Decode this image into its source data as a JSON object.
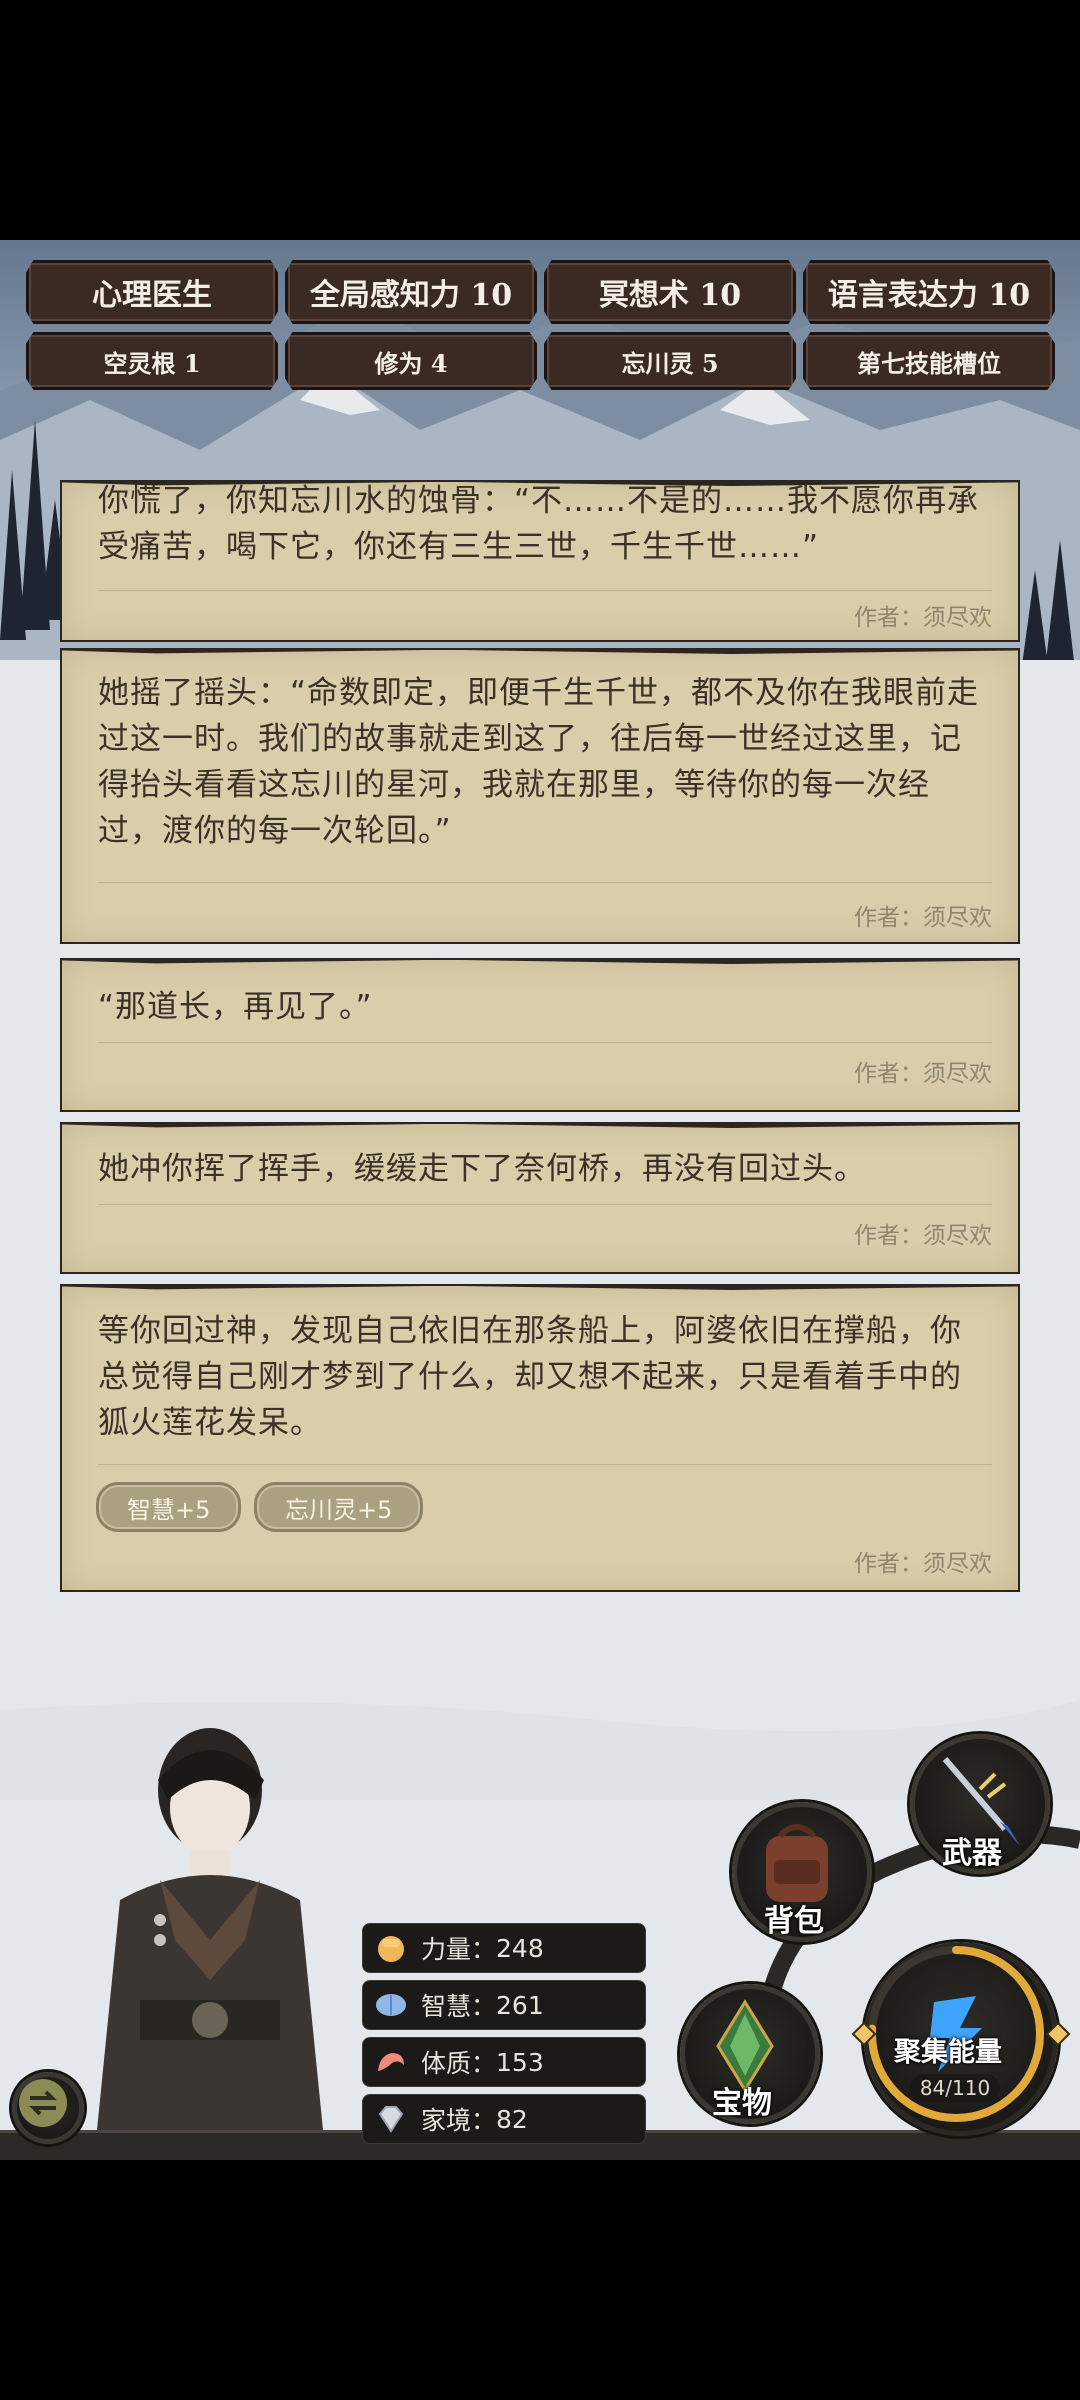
{
  "skills": {
    "row1": [
      "心理医生",
      "全局感知力 10",
      "冥想术 10",
      "语言表达力 10"
    ],
    "row2": [
      "空灵根 1",
      "修为 4",
      "忘川灵 5",
      "第七技能槽位"
    ]
  },
  "story_cards": [
    {
      "text": "你慌了，你知忘川水的蚀骨：“不……不是的……我不愿你再承受痛苦，喝下它，你还有三生三世，千生千世……”",
      "author": "作者：须尽欢"
    },
    {
      "text": "她摇了摇头：“命数即定，即便千生千世，都不及你在我眼前走过这一时。我们的故事就走到这了，往后每一世经过这里，记得抬头看看这忘川的星河，我就在那里，等待你的每一次经过，渡你的每一次轮回。”",
      "author": "作者：须尽欢"
    },
    {
      "text": "“那道长，再见了。”",
      "author": "作者：须尽欢"
    },
    {
      "text": "她冲你挥了挥手，缓缓走下了奈何桥，再没有回过头。",
      "author": "作者：须尽欢"
    },
    {
      "text": "等你回过神，发现自己依旧在那条船上，阿婆依旧在撑船，你总觉得自己刚才梦到了什么，却又想不起来，只是看着手中的狐火莲花发呆。",
      "author": "作者：须尽欢",
      "tags": [
        "智慧+5",
        "忘川灵+5"
      ]
    }
  ],
  "stats": [
    {
      "icon": "fist-icon",
      "label": "力量：",
      "value": "248"
    },
    {
      "icon": "brain-icon",
      "label": "智慧：",
      "value": "261"
    },
    {
      "icon": "muscle-icon",
      "label": "体质：",
      "value": "153"
    },
    {
      "icon": "diamond-icon",
      "label": "家境：",
      "value": "82"
    }
  ],
  "actions": {
    "weapon": "武器",
    "backpack": "背包",
    "treasure": "宝物",
    "gather": "聚集能量",
    "energy": "84/110"
  },
  "energy_fraction": 0.76,
  "colors": {
    "card_bg": "#d9ceaa",
    "skill_bg": "#3b2a23",
    "panel_bg": "#2c2a26",
    "energy_ring": "#e0a93a"
  }
}
